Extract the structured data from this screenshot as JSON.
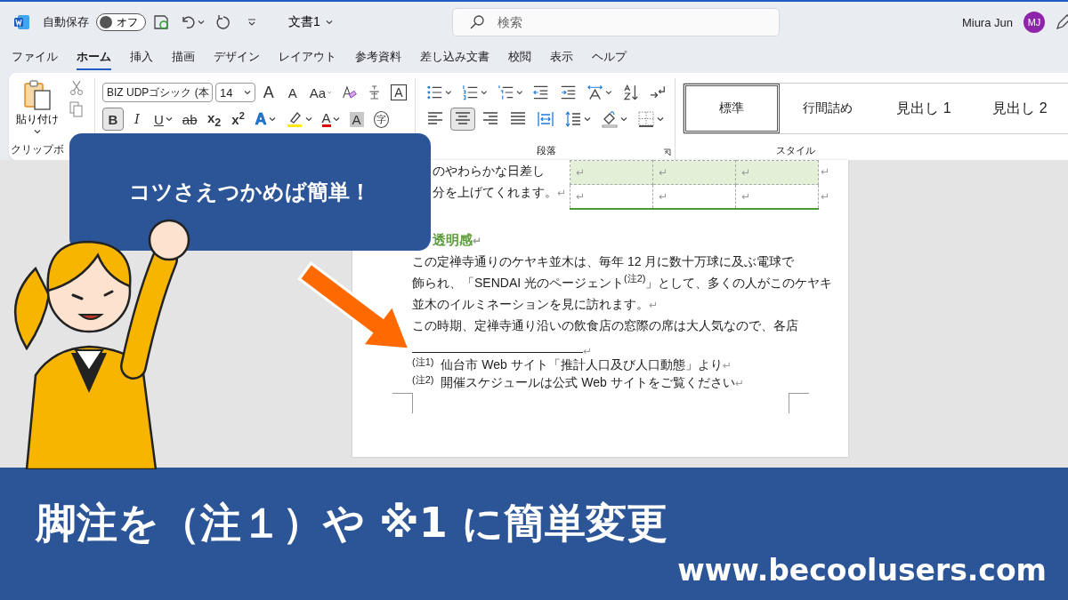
{
  "title_bar": {
    "autosave_label": "自動保存",
    "autosave_toggle": {
      "label": "オフ",
      "on": false
    },
    "document_title": "文書1",
    "search": {
      "placeholder": "検索"
    },
    "user_name": "Miura Jun",
    "avatar": "MJ"
  },
  "tabs": [
    {
      "label": "ファイル",
      "selected": false
    },
    {
      "label": "ホーム",
      "selected": true
    },
    {
      "label": "挿入",
      "selected": false
    },
    {
      "label": "描画",
      "selected": false
    },
    {
      "label": "デザイン",
      "selected": false
    },
    {
      "label": "レイアウト",
      "selected": false
    },
    {
      "label": "参考資料",
      "selected": false
    },
    {
      "label": "差し込み文書",
      "selected": false
    },
    {
      "label": "校閲",
      "selected": false
    },
    {
      "label": "表示",
      "selected": false
    },
    {
      "label": "ヘルプ",
      "selected": false
    }
  ],
  "ribbon": {
    "clipboard": {
      "paste_label": "貼り付け",
      "group_label": "クリップボ"
    },
    "font": {
      "font_name": "BIZ UDPゴシック (本",
      "font_size": "14",
      "row1": [
        {
          "kind": "grow",
          "label": "A",
          "on": false
        },
        {
          "kind": "shrink",
          "label": "A",
          "on": false
        },
        {
          "kind": "case",
          "label": "Aa",
          "on": false,
          "dropdown": true
        },
        {
          "kind": "clear",
          "on": false
        },
        {
          "kind": "phonetic",
          "on": false
        },
        {
          "kind": "border",
          "label": "A",
          "on": false
        }
      ],
      "row2": [
        {
          "kind": "bold",
          "label": "B",
          "on": true
        },
        {
          "kind": "italic",
          "label": "I",
          "on": false
        },
        {
          "kind": "underline",
          "label": "U",
          "on": false,
          "dropdown": true
        },
        {
          "kind": "strike",
          "label": "ab",
          "on": false
        },
        {
          "kind": "sub",
          "label": "x$_{2}$",
          "on": false
        },
        {
          "kind": "sup",
          "label": "x$^{2}$",
          "on": false
        },
        {
          "kind": "effect",
          "label": "A",
          "on": false,
          "dropdown": true
        },
        {
          "kind": "highlight",
          "on": false,
          "dropdown": true
        },
        {
          "kind": "color",
          "label": "A",
          "on": false,
          "dropdown": true
        },
        {
          "kind": "shade",
          "label": "A",
          "on": false
        },
        {
          "kind": "enclose",
          "label": "字",
          "on": false
        }
      ]
    },
    "paragraph": {
      "group_label": "段落",
      "row1": [
        {
          "kind": "bullets",
          "on": false,
          "dropdown": true
        },
        {
          "kind": "numbering",
          "on": false,
          "dropdown": true
        },
        {
          "kind": "multilevel",
          "on": false,
          "dropdown": true
        },
        {
          "kind": "outdent",
          "on": false
        },
        {
          "kind": "indent",
          "on": false
        },
        {
          "kind": "direction",
          "on": false,
          "dropdown": true
        },
        {
          "kind": "sort",
          "on": false
        },
        {
          "kind": "marks",
          "on": false
        }
      ],
      "row2": [
        {
          "kind": "left",
          "on": false
        },
        {
          "kind": "center",
          "on": true
        },
        {
          "kind": "right",
          "on": false
        },
        {
          "kind": "justify",
          "on": false
        },
        {
          "kind": "distribute",
          "on": false
        },
        {
          "kind": "spacing",
          "on": false,
          "dropdown": true
        },
        {
          "kind": "fill",
          "on": false,
          "dropdown": true
        },
        {
          "kind": "borders",
          "on": false,
          "dropdown": true
        }
      ]
    },
    "styles": {
      "group_label": "スタイル",
      "items": [
        {
          "label": "標準",
          "selected": true
        },
        {
          "label": "行間詰め",
          "selected": false
        },
        {
          "label": "見出し 1",
          "selected": false
        },
        {
          "label": "見出し 2",
          "selected": false
        }
      ]
    }
  },
  "document": {
    "side_lines": [
      {
        "text": "のやわらかな日差し"
      },
      {
        "text": "分を上げてくれます。",
        "mark": "↵"
      }
    ],
    "table": [
      {
        "shaded": true,
        "cells": [
          "↵",
          "↵",
          "↵"
        ],
        "end": "↵"
      },
      {
        "shaded": false,
        "cells": [
          "↵",
          "↵",
          "↵"
        ],
        "end": "↵"
      }
    ],
    "heading": {
      "text": "透明感",
      "mark": "↵"
    },
    "body": [
      {
        "text": "この定禅寺通りのケヤキ並木は、毎年 12 月に数十万球に及ぶ電球で"
      },
      {
        "text": "飾られ、「SENDAI 光のページェント$^{(注2)}$」として、多くの人がこのケヤキ"
      },
      {
        "text": "並木のイルミネーションを見に訪れます。",
        "mark": "↵"
      },
      {
        "text": "この時期、定禅寺通り沿いの飲食店の窓際の席は大人気なので、各店"
      }
    ],
    "separator_mark": "↵",
    "footnotes": [
      {
        "ref": "(注1)",
        "text": "仙台市 Web サイト「推計人口及び人口動態」より",
        "mark": "↵"
      },
      {
        "ref": "(注2)",
        "text": "開催スケジュールは公式 Web サイトをご覧ください",
        "mark": "↵"
      }
    ]
  },
  "callout": "コツさえつかめば簡単！",
  "banner": {
    "title": "脚注を（注１）や ※1 に簡単変更",
    "url": "www.becoolusers.com"
  }
}
